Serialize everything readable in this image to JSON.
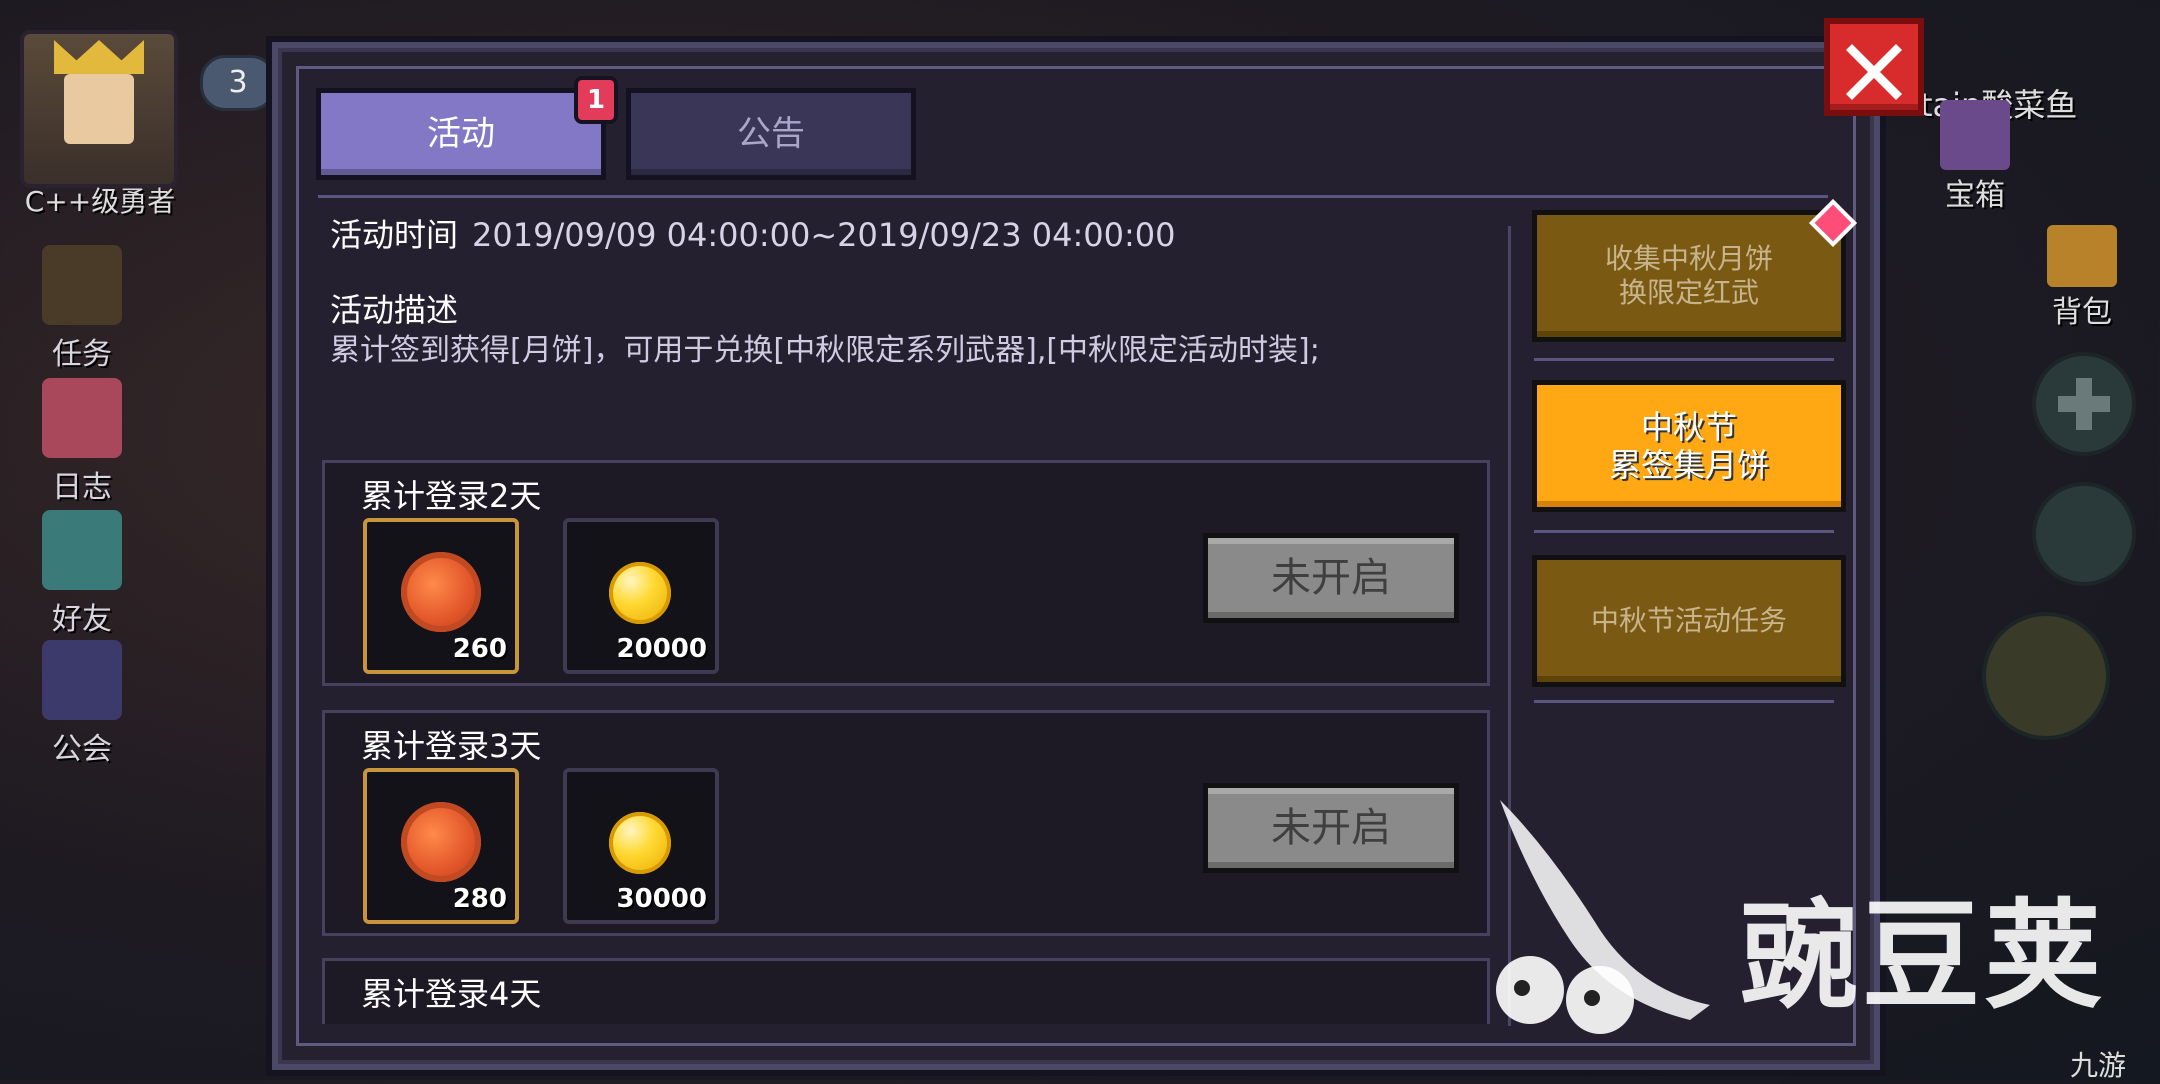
{
  "hud_left": {
    "player_name": "C++级勇者",
    "level": "3",
    "items": [
      "任务",
      "日志",
      "好友",
      "公会"
    ]
  },
  "hud_right": {
    "top_label": "tain酸菜鱼",
    "chest": "宝箱",
    "bag": "背包"
  },
  "dialog": {
    "tabs": [
      {
        "label": "活动",
        "active": true
      },
      {
        "label": "公告",
        "active": false
      }
    ],
    "badge": "1",
    "event_time_label": "活动时间",
    "event_time_value": "2019/09/09 04:00:00~2019/09/23 04:00:00",
    "desc_title": "活动描述",
    "desc_text": "累计签到获得[月饼]，可用于兑换[中秋限定系列武器],[中秋限定活动时装];",
    "rewards": [
      {
        "title": "累计登录2天",
        "mooncake": "260",
        "coins": "20000",
        "status": "未开启"
      },
      {
        "title": "累计登录3天",
        "mooncake": "280",
        "coins": "30000",
        "status": "未开启"
      },
      {
        "title": "累计登录4天"
      }
    ],
    "side_buttons": [
      {
        "line1": "收集中秋月饼",
        "line2": "换限定红武",
        "state": "dim"
      },
      {
        "line1": "中秋节",
        "line2": "累签集月饼",
        "state": "selected"
      },
      {
        "line1": "中秋节活动任务",
        "line2": "",
        "state": "dim"
      }
    ]
  },
  "watermark": "豌豆荚",
  "corner_logo": "九游",
  "colors": {
    "tab_active": "#8278c6",
    "selected": "#ffa814",
    "dim": "#7a5a12",
    "close": "#d82c2c"
  }
}
